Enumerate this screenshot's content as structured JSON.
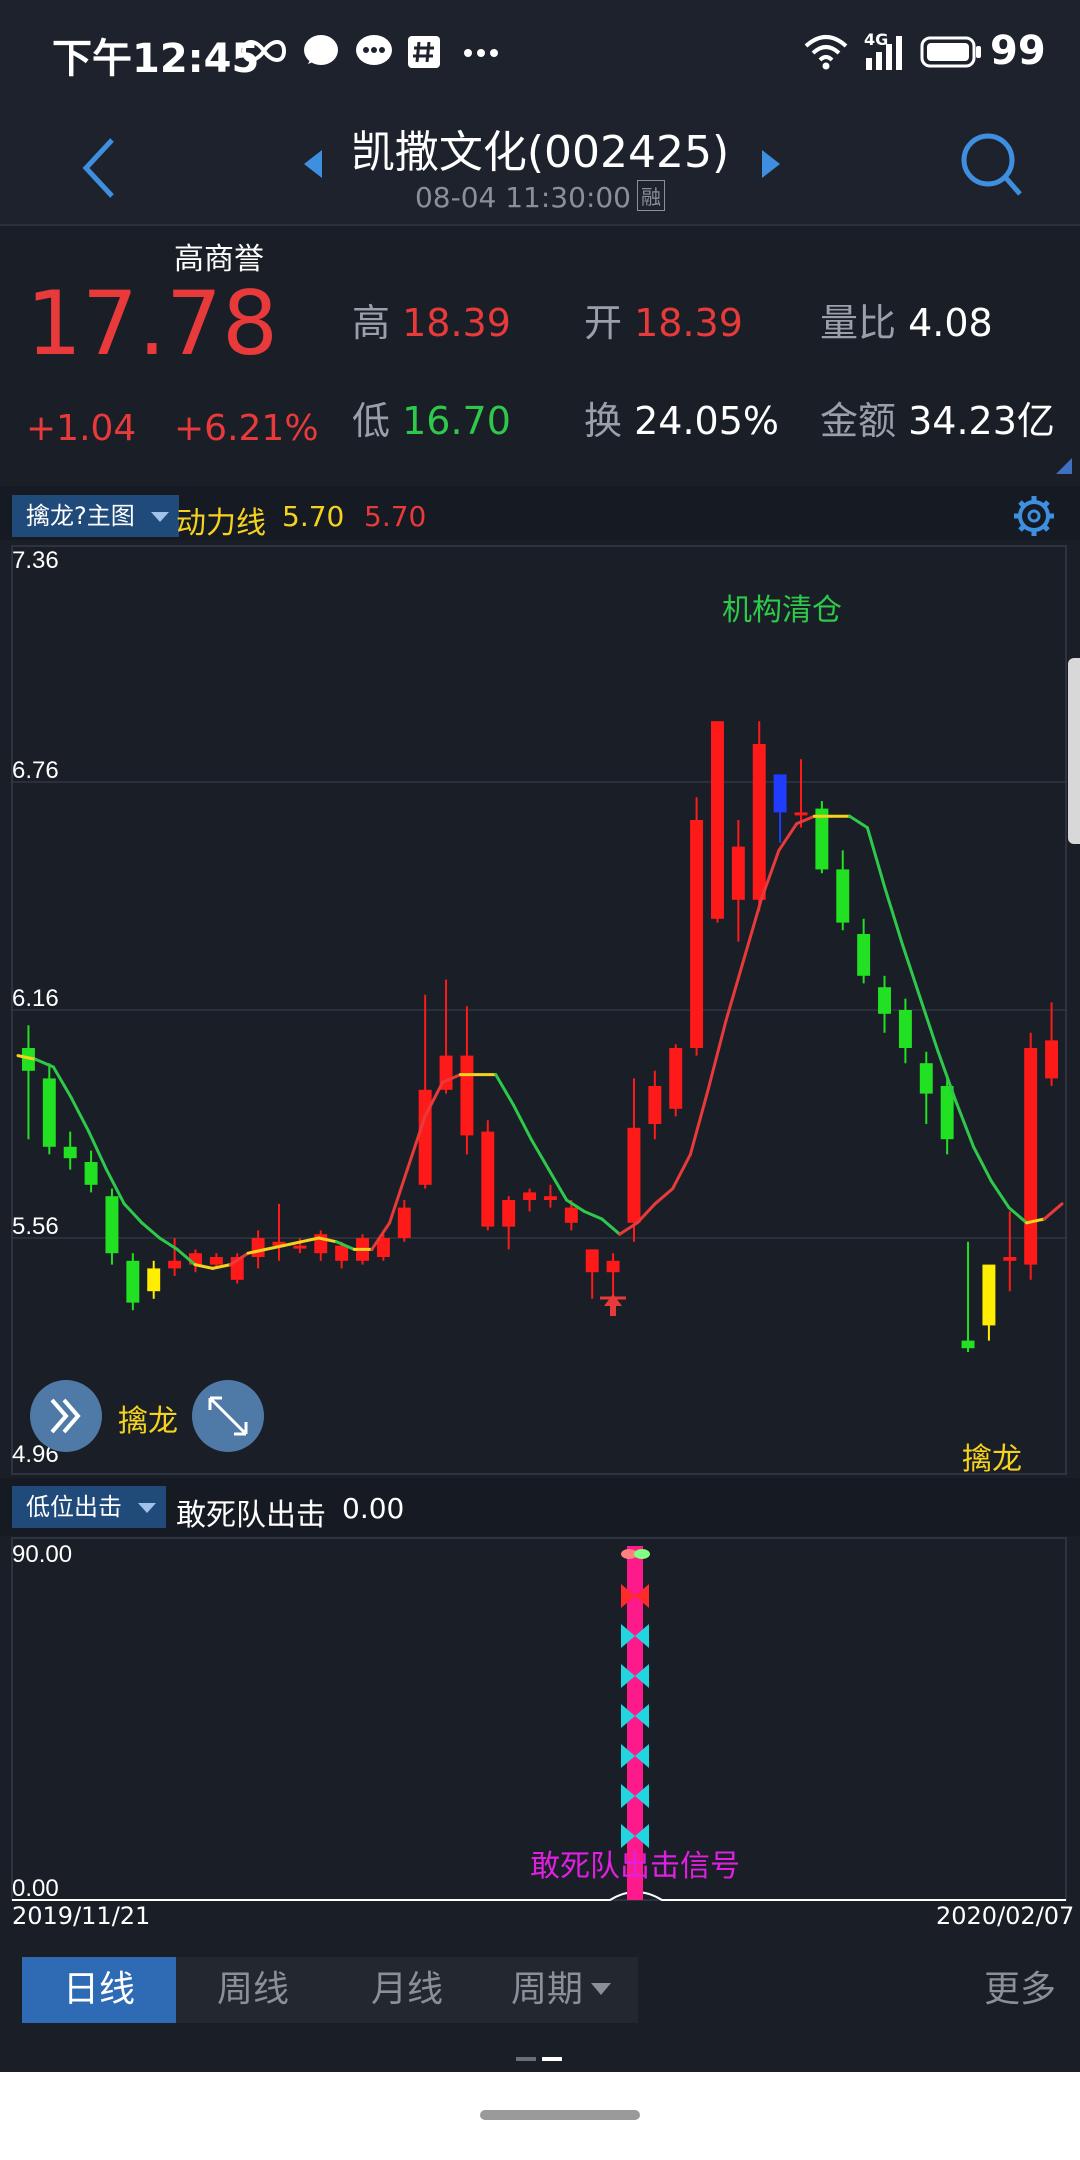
{
  "status_bar": {
    "time": "下午12:45",
    "battery": "99",
    "network": "4G",
    "icons": [
      "infinity-icon",
      "chat-bubble-icon",
      "message-icon",
      "hashtag-icon",
      "more-dots-icon",
      "wifi-icon",
      "signal-icon",
      "battery-icon"
    ]
  },
  "header": {
    "title": "凯撒文化(002425)",
    "datetime": "08-04 11:30:00",
    "badge": "融"
  },
  "quote": {
    "name": "高商誉",
    "price": "17.78",
    "change": "+1.04",
    "change_pct": "+6.21%",
    "high_label": "高",
    "high": "18.39",
    "open_label": "开",
    "open": "18.39",
    "vol_ratio_label": "量比",
    "vol_ratio": "4.08",
    "low_label": "低",
    "low": "16.70",
    "turnover_label": "换",
    "turnover": "24.05%",
    "amount_label": "金额",
    "amount": "34.23亿"
  },
  "main_chart": {
    "selector": "擒龙?主图",
    "indicator_label": "动力线",
    "indicator_v1": "5.70",
    "indicator_v2": "5.70",
    "annotation_top": "机构清仓",
    "annotation_bottom": "擒龙",
    "annotation_right": "擒龙"
  },
  "sub_chart": {
    "selector": "低位出击",
    "title": "敢死队出击",
    "value": "0.00",
    "signal_label": "敢死队出击信号"
  },
  "dates": {
    "start": "2019/11/21",
    "end": "2020/02/07"
  },
  "tabs": {
    "day": "日线",
    "week": "周线",
    "month": "月线",
    "period": "周期",
    "more": "更多"
  },
  "colors": {
    "up": "#e83a3a",
    "down": "#2ec84a",
    "line_yellow": "#f5d21e",
    "accent": "#2f6bb5"
  },
  "chart_data": [
    {
      "type": "candlestick",
      "y_ticks": [
        "7.36",
        "6.76",
        "6.16",
        "5.56",
        "4.96"
      ],
      "ylim": [
        4.96,
        7.36
      ],
      "grid": true,
      "candles": [
        {
          "o": 6.06,
          "h": 6.12,
          "l": 5.82,
          "c": 6.0,
          "color": "green"
        },
        {
          "o": 5.98,
          "h": 6.02,
          "l": 5.78,
          "c": 5.8,
          "color": "green"
        },
        {
          "o": 5.8,
          "h": 5.84,
          "l": 5.74,
          "c": 5.77,
          "color": "green"
        },
        {
          "o": 5.76,
          "h": 5.79,
          "l": 5.68,
          "c": 5.7,
          "color": "green"
        },
        {
          "o": 5.67,
          "h": 5.69,
          "l": 5.49,
          "c": 5.52,
          "color": "green"
        },
        {
          "o": 5.5,
          "h": 5.52,
          "l": 5.37,
          "c": 5.39,
          "color": "green"
        },
        {
          "o": 5.42,
          "h": 5.5,
          "l": 5.4,
          "c": 5.48,
          "color": "yellow"
        },
        {
          "o": 5.48,
          "h": 5.56,
          "l": 5.46,
          "c": 5.5,
          "color": "red"
        },
        {
          "o": 5.49,
          "h": 5.53,
          "l": 5.47,
          "c": 5.52,
          "color": "red"
        },
        {
          "o": 5.49,
          "h": 5.52,
          "l": 5.48,
          "c": 5.51,
          "color": "red"
        },
        {
          "o": 5.45,
          "h": 5.52,
          "l": 5.44,
          "c": 5.51,
          "color": "red"
        },
        {
          "o": 5.51,
          "h": 5.58,
          "l": 5.48,
          "c": 5.56,
          "color": "red"
        },
        {
          "o": 5.54,
          "h": 5.65,
          "l": 5.5,
          "c": 5.55,
          "color": "red"
        },
        {
          "o": 5.54,
          "h": 5.56,
          "l": 5.52,
          "c": 5.54,
          "color": "red"
        },
        {
          "o": 5.52,
          "h": 5.58,
          "l": 5.5,
          "c": 5.57,
          "color": "red"
        },
        {
          "o": 5.5,
          "h": 5.55,
          "l": 5.48,
          "c": 5.54,
          "color": "red"
        },
        {
          "o": 5.5,
          "h": 5.57,
          "l": 5.49,
          "c": 5.56,
          "color": "red"
        },
        {
          "o": 5.51,
          "h": 5.57,
          "l": 5.5,
          "c": 5.56,
          "color": "red"
        },
        {
          "o": 5.56,
          "h": 5.66,
          "l": 5.55,
          "c": 5.64,
          "color": "red"
        },
        {
          "o": 5.7,
          "h": 6.2,
          "l": 5.69,
          "c": 5.95,
          "color": "red"
        },
        {
          "o": 5.95,
          "h": 6.24,
          "l": 5.94,
          "c": 6.04,
          "color": "red"
        },
        {
          "o": 6.04,
          "h": 6.17,
          "l": 5.78,
          "c": 5.83,
          "color": "red"
        },
        {
          "o": 5.84,
          "h": 5.87,
          "l": 5.58,
          "c": 5.59,
          "color": "red"
        },
        {
          "o": 5.59,
          "h": 5.67,
          "l": 5.53,
          "c": 5.66,
          "color": "red"
        },
        {
          "o": 5.66,
          "h": 5.69,
          "l": 5.63,
          "c": 5.68,
          "color": "red"
        },
        {
          "o": 5.67,
          "h": 5.7,
          "l": 5.64,
          "c": 5.66,
          "color": "red"
        },
        {
          "o": 5.6,
          "h": 5.66,
          "l": 5.58,
          "c": 5.64,
          "color": "red"
        },
        {
          "o": 5.47,
          "h": 5.53,
          "l": 5.4,
          "c": 5.53,
          "color": "red"
        },
        {
          "o": 5.47,
          "h": 5.52,
          "l": 5.37,
          "c": 5.5,
          "color": "red"
        },
        {
          "o": 5.6,
          "h": 5.98,
          "l": 5.55,
          "c": 5.85,
          "color": "red"
        },
        {
          "o": 5.86,
          "h": 6.0,
          "l": 5.82,
          "c": 5.96,
          "color": "red"
        },
        {
          "o": 5.9,
          "h": 6.07,
          "l": 5.88,
          "c": 6.06,
          "color": "red"
        },
        {
          "o": 6.06,
          "h": 6.72,
          "l": 6.04,
          "c": 6.66,
          "color": "red"
        },
        {
          "o": 6.4,
          "h": 6.92,
          "l": 6.39,
          "c": 6.92,
          "color": "red"
        },
        {
          "o": 6.45,
          "h": 6.66,
          "l": 6.34,
          "c": 6.59,
          "color": "red"
        },
        {
          "o": 6.45,
          "h": 6.92,
          "l": 6.42,
          "c": 6.86,
          "color": "red"
        },
        {
          "o": 6.68,
          "h": 6.78,
          "l": 6.6,
          "c": 6.78,
          "color": "blue"
        },
        {
          "o": 6.68,
          "h": 6.82,
          "l": 6.64,
          "c": 6.68,
          "color": "red"
        },
        {
          "o": 6.69,
          "h": 6.71,
          "l": 6.52,
          "c": 6.53,
          "color": "green"
        },
        {
          "o": 6.53,
          "h": 6.58,
          "l": 6.37,
          "c": 6.39,
          "color": "green"
        },
        {
          "o": 6.36,
          "h": 6.4,
          "l": 6.23,
          "c": 6.25,
          "color": "green"
        },
        {
          "o": 6.22,
          "h": 6.25,
          "l": 6.1,
          "c": 6.15,
          "color": "green"
        },
        {
          "o": 6.16,
          "h": 6.19,
          "l": 6.02,
          "c": 6.06,
          "color": "green"
        },
        {
          "o": 6.02,
          "h": 6.05,
          "l": 5.86,
          "c": 5.94,
          "color": "green"
        },
        {
          "o": 5.96,
          "h": 5.99,
          "l": 5.78,
          "c": 5.82,
          "color": "green"
        },
        {
          "o": 5.27,
          "h": 5.55,
          "l": 5.26,
          "c": 5.29,
          "color": "green"
        },
        {
          "o": 5.33,
          "h": 5.46,
          "l": 5.29,
          "c": 5.49,
          "color": "yellow"
        },
        {
          "o": 5.5,
          "h": 5.63,
          "l": 5.42,
          "c": 5.51,
          "color": "red"
        },
        {
          "o": 5.49,
          "h": 6.1,
          "l": 5.45,
          "c": 6.06,
          "color": "red"
        },
        {
          "o": 5.98,
          "h": 6.18,
          "l": 5.96,
          "c": 6.08,
          "color": "red"
        }
      ],
      "power_line": [
        6.04,
        6.03,
        6.01,
        5.93,
        5.84,
        5.74,
        5.65,
        5.6,
        5.56,
        5.53,
        5.49,
        5.48,
        5.49,
        5.52,
        5.53,
        5.54,
        5.55,
        5.56,
        5.55,
        5.53,
        5.53,
        5.6,
        5.74,
        5.88,
        5.97,
        5.99,
        5.99,
        5.99,
        5.91,
        5.82,
        5.74,
        5.66,
        5.63,
        5.61,
        5.57,
        5.6,
        5.65,
        5.69,
        5.78,
        5.95,
        6.13,
        6.29,
        6.45,
        6.58,
        6.65,
        6.67,
        6.67,
        6.67,
        6.64,
        6.48,
        6.33,
        6.19,
        6.05,
        5.92,
        5.8,
        5.71,
        5.64,
        5.6,
        5.61,
        5.65
      ]
    },
    {
      "type": "bar",
      "title": "敢死队出击",
      "y_ticks": [
        "90.00",
        "0.00"
      ],
      "ylim": [
        0,
        90
      ],
      "signal_index": 29,
      "signal_value": 90
    }
  ]
}
